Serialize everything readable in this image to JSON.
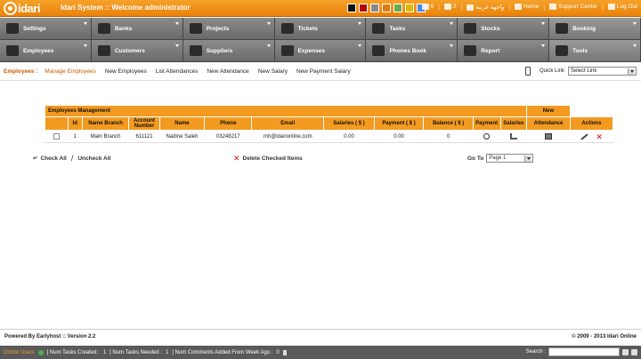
{
  "header": {
    "logo_text": "idari",
    "title": "Idari System :: Welcome administrator",
    "swatches": [
      "#111111",
      "#b00000",
      "#888888",
      "#e07a12",
      "#6aa84f",
      "#e0b800",
      "#4a86e8"
    ],
    "messages_count": "0",
    "notif_count": "2",
    "arabic_label": "واجهة عربية",
    "home_label": "Home",
    "support_label": "Support Center",
    "logout_label": "Log Out"
  },
  "menu": {
    "row1": [
      "Settings",
      "Banks",
      "Projects",
      "Tickets",
      "Tasks",
      "Stocks",
      "Booking"
    ],
    "row2": [
      "Employees",
      "Customers",
      "Suppliers",
      "Expenses",
      "Phones Book",
      "Report",
      "Tools"
    ]
  },
  "submenu": {
    "current": "Employees :",
    "links": [
      "Manage Employees",
      "New Employees",
      "List Attendances",
      "New Attendance",
      "New Salary",
      "New Payment Salary"
    ],
    "quick_label": "Quick Link",
    "quick_select": "Select Link"
  },
  "table": {
    "section_title": "Employees Management",
    "new_label": "New",
    "columns": [
      "Id",
      "Name Branch",
      "Account Number",
      "Name",
      "Phone",
      "Email",
      "Salaries ( $ )",
      "Payment ( $ )",
      "Balance ( $ )",
      "Payment",
      "Salaries",
      "Attendance",
      "Actions"
    ],
    "rows": [
      {
        "id": "1",
        "branch": "Main Branch",
        "account": "611121",
        "name": "Nadine Saleh",
        "phone": "03248217",
        "email": "mh@idarionline.com",
        "salaries": "0.00",
        "payment": "0.00",
        "balance": "0"
      }
    ]
  },
  "actions": {
    "check_all": "Check All",
    "uncheck_all": "Uncheck All",
    "delete_checked": "Delete Checked Items",
    "goto_label": "Go To",
    "goto_page": "Page 1"
  },
  "footer": {
    "powered": "Powered By Earlyhost :: Version 2.2",
    "copyright": "© 2009 - 2013 Idari Online"
  },
  "statusbar": {
    "users_online": "Online Users",
    "tasks_created_label": "| Num Tasks Created :",
    "tasks_created": "1",
    "tasks_needed_label": "| Num Tasks Needed :",
    "tasks_needed": "1",
    "comments_label": "| Num Comments Added From Week Ago :",
    "comments": "0",
    "search_label": "Search :"
  }
}
